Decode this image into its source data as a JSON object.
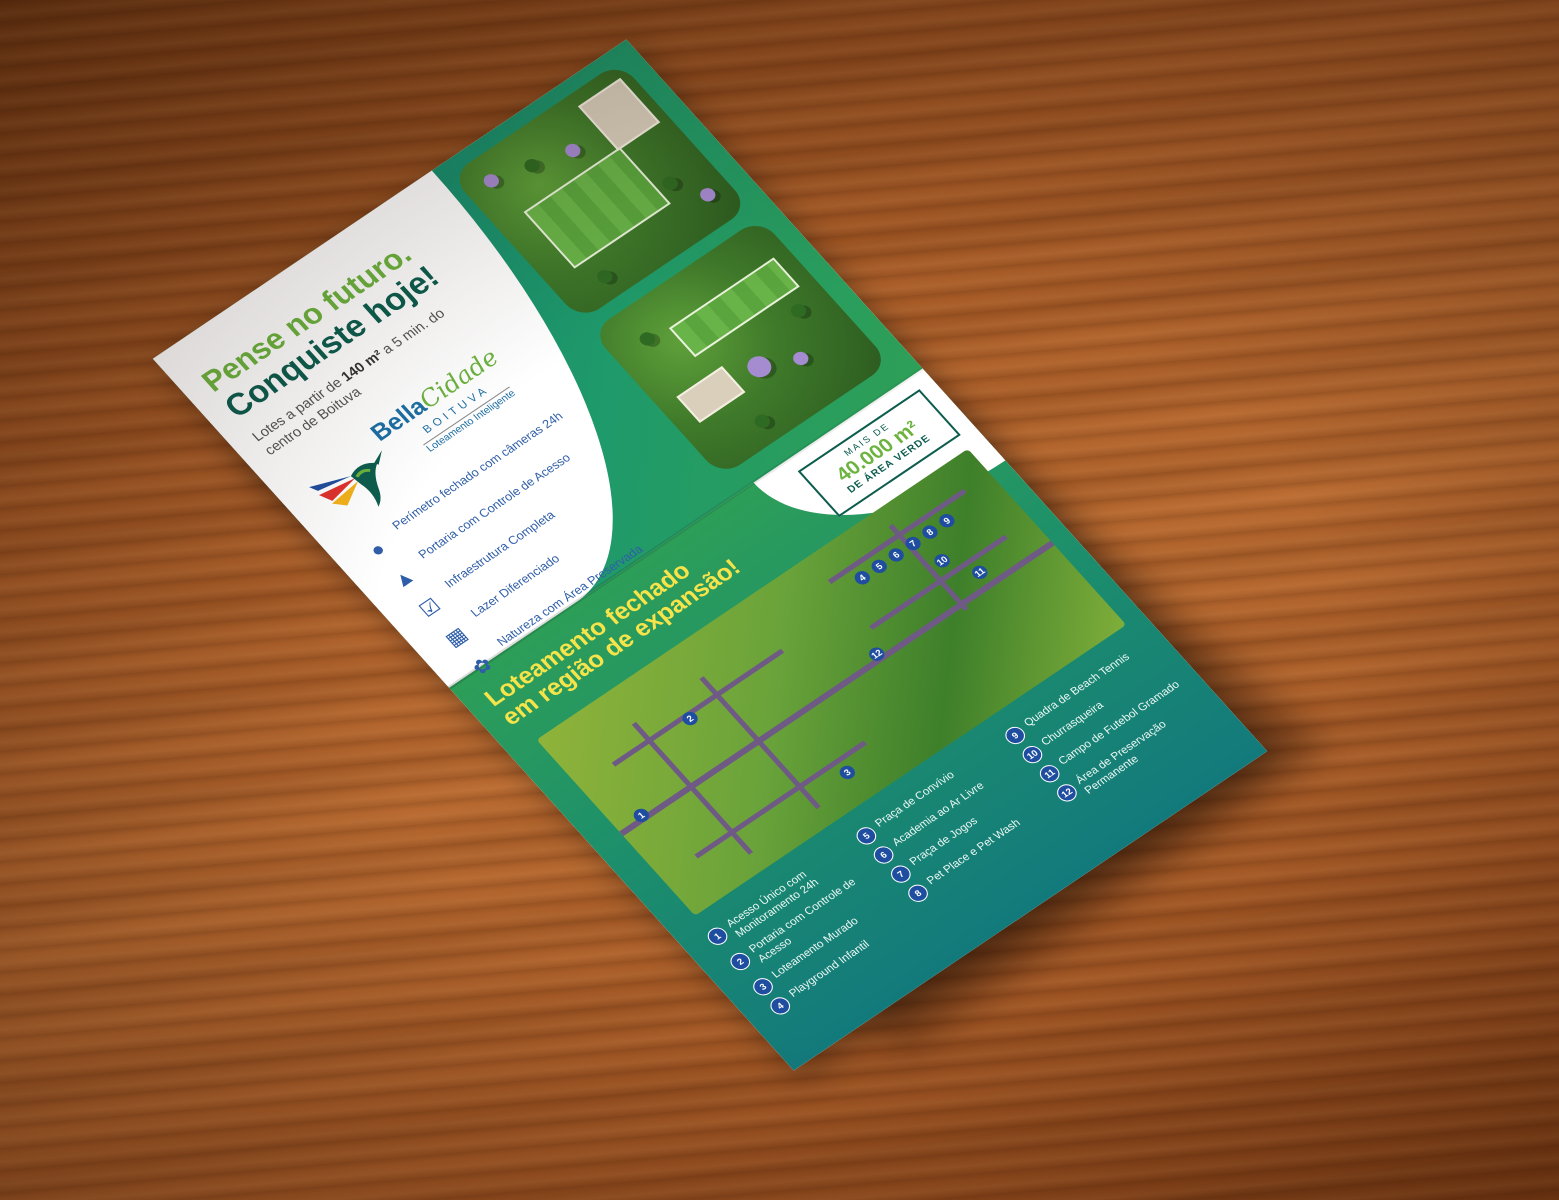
{
  "flyer": {
    "headline_line1": "Pense no futuro.",
    "headline_line2": "Conquiste hoje!",
    "subtitle_prefix": "Lotes a partir de ",
    "subtitle_bold": "140 m²",
    "subtitle_suffix": " a 5 min. do centro de Boituva",
    "logo": {
      "name_part1": "Bella",
      "name_part2": "Cidade",
      "city": "BOITUVA",
      "tagline": "Loteamento Inteligente"
    },
    "features": [
      {
        "icon": "camera-icon",
        "label": "Perímetro fechado com câmeras 24h"
      },
      {
        "icon": "gate-icon",
        "label": "Portaria com Controle de Acesso"
      },
      {
        "icon": "checklist-icon",
        "label": "Infraestrutura Completa"
      },
      {
        "icon": "calendar-icon",
        "label": "Lazer Diferenciado"
      },
      {
        "icon": "plant-icon",
        "label": "Natureza com Área Preservada"
      }
    ],
    "green_badge": {
      "line1": "MAIS DE",
      "line2": "40.000 m²",
      "line3": "DE ÁREA VERDE"
    },
    "bottom_title_line1": "Loteamento fechado",
    "bottom_title_line2": "em região de expansão!",
    "amenities_col1": [
      {
        "n": "1",
        "label": "Acesso Único com Monitoramento 24h"
      },
      {
        "n": "2",
        "label": "Portaria com Controle de Acesso"
      },
      {
        "n": "3",
        "label": "Loteamento Murado"
      },
      {
        "n": "4",
        "label": "Playground Infantil"
      }
    ],
    "amenities_col2": [
      {
        "n": "5",
        "label": "Praça de Convívio"
      },
      {
        "n": "6",
        "label": "Academia ao Ar Livre"
      },
      {
        "n": "7",
        "label": "Praça de Jogos"
      },
      {
        "n": "8",
        "label": "Pet Place e Pet Wash"
      }
    ],
    "amenities_col3": [
      {
        "n": "9",
        "label": "Quadra de Beach Tennis"
      },
      {
        "n": "10",
        "label": "Churrasqueira"
      },
      {
        "n": "11",
        "label": "Campo de Futebol Gramado"
      },
      {
        "n": "12",
        "label": "Área de Preservação Permanente"
      }
    ],
    "map_pins": [
      "1",
      "2",
      "3",
      "4",
      "5",
      "6",
      "7",
      "8",
      "9",
      "10",
      "11",
      "12"
    ],
    "colors": {
      "brand_green": "#6db33f",
      "dark_green": "#0d5d4e",
      "teal": "#137a7c",
      "accent_yellow": "#f6e44a",
      "brand_blue": "#1f4ea0"
    }
  }
}
